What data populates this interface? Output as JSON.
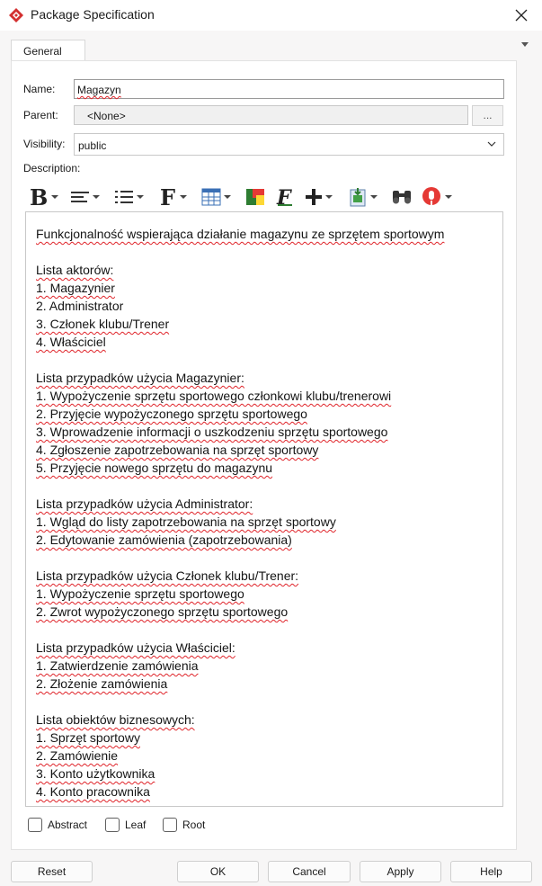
{
  "window": {
    "title": "Package Specification"
  },
  "tabs": [
    {
      "label": "General"
    }
  ],
  "form": {
    "name_label": "Name:",
    "name_value": "Magazyn",
    "parent_label": "Parent:",
    "parent_value": "<None>",
    "browse_label": "...",
    "visibility_label": "Visibility:",
    "visibility_value": "public",
    "description_label": "Description:"
  },
  "toolbar": {
    "icons": [
      "bold-icon",
      "align-icon",
      "list-icon",
      "font-icon",
      "table-icon",
      "color-icon",
      "format-icon",
      "insert-icon",
      "link-icon",
      "find-icon",
      "spellcheck-icon"
    ]
  },
  "description_lines": [
    "Funkcjonalność wspierająca działanie magazynu ze sprzętem sportowym",
    "",
    "Lista aktorów:",
    "1. Magazynier",
    "2. Administrator",
    "3. Członek klubu/Trener",
    "4. Właściciel",
    "",
    "Lista przypadków użycia Magazynier:",
    "1. Wypożyczenie sprzętu sportowego członkowi klubu/trenerowi",
    "2. Przyjęcie wypożyczonego sprzętu sportowego",
    "3. Wprowadzenie informacji o uszkodzeniu sprzętu sportowego",
    "4. Zgłoszenie zapotrzebowania na sprzęt sportowy",
    "5. Przyjęcie nowego sprzętu do magazynu",
    "",
    "Lista przypadków użycia Administrator:",
    "1. Wgląd do listy zapotrzebowania na sprzęt sportowy",
    "2. Edytowanie zamówienia (zapotrzebowania)",
    "",
    "Lista przypadków użycia Członek klubu/Trener:",
    "1. Wypożyczenie sprzętu sportowego",
    "2. Zwrot wypożyczonego sprzętu sportowego",
    "",
    "Lista przypadków użycia Właściciel:",
    "1. Zatwierdzenie zamówienia",
    "2. Złożenie zamówienia",
    "",
    "Lista obiektów biznesowych:",
    "1. Sprzęt sportowy",
    "2. Zamówienie",
    "3. Konto użytkownika",
    "4. Konto pracownika"
  ],
  "checkboxes": [
    {
      "label": "Abstract",
      "checked": false
    },
    {
      "label": "Leaf",
      "checked": false
    },
    {
      "label": "Root",
      "checked": false
    }
  ],
  "buttons": {
    "reset": "Reset",
    "ok": "OK",
    "cancel": "Cancel",
    "apply": "Apply",
    "help": "Help"
  },
  "colors": {
    "accent_red": "#d32f2f",
    "spell_underline": "#e0242a",
    "panel_bg": "#ffffff",
    "window_bg": "#f7f6f6"
  }
}
